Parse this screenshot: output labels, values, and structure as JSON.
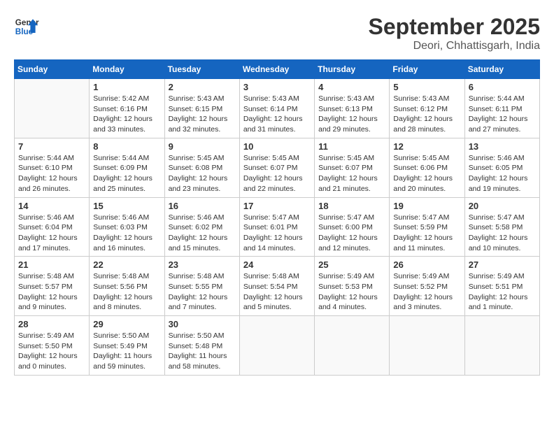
{
  "header": {
    "logo_general": "General",
    "logo_blue": "Blue",
    "month": "September 2025",
    "location": "Deori, Chhattisgarh, India"
  },
  "days_of_week": [
    "Sunday",
    "Monday",
    "Tuesday",
    "Wednesday",
    "Thursday",
    "Friday",
    "Saturday"
  ],
  "weeks": [
    [
      {
        "day": "",
        "info": ""
      },
      {
        "day": "1",
        "info": "Sunrise: 5:42 AM\nSunset: 6:16 PM\nDaylight: 12 hours\nand 33 minutes."
      },
      {
        "day": "2",
        "info": "Sunrise: 5:43 AM\nSunset: 6:15 PM\nDaylight: 12 hours\nand 32 minutes."
      },
      {
        "day": "3",
        "info": "Sunrise: 5:43 AM\nSunset: 6:14 PM\nDaylight: 12 hours\nand 31 minutes."
      },
      {
        "day": "4",
        "info": "Sunrise: 5:43 AM\nSunset: 6:13 PM\nDaylight: 12 hours\nand 29 minutes."
      },
      {
        "day": "5",
        "info": "Sunrise: 5:43 AM\nSunset: 6:12 PM\nDaylight: 12 hours\nand 28 minutes."
      },
      {
        "day": "6",
        "info": "Sunrise: 5:44 AM\nSunset: 6:11 PM\nDaylight: 12 hours\nand 27 minutes."
      }
    ],
    [
      {
        "day": "7",
        "info": "Sunrise: 5:44 AM\nSunset: 6:10 PM\nDaylight: 12 hours\nand 26 minutes."
      },
      {
        "day": "8",
        "info": "Sunrise: 5:44 AM\nSunset: 6:09 PM\nDaylight: 12 hours\nand 25 minutes."
      },
      {
        "day": "9",
        "info": "Sunrise: 5:45 AM\nSunset: 6:08 PM\nDaylight: 12 hours\nand 23 minutes."
      },
      {
        "day": "10",
        "info": "Sunrise: 5:45 AM\nSunset: 6:07 PM\nDaylight: 12 hours\nand 22 minutes."
      },
      {
        "day": "11",
        "info": "Sunrise: 5:45 AM\nSunset: 6:07 PM\nDaylight: 12 hours\nand 21 minutes."
      },
      {
        "day": "12",
        "info": "Sunrise: 5:45 AM\nSunset: 6:06 PM\nDaylight: 12 hours\nand 20 minutes."
      },
      {
        "day": "13",
        "info": "Sunrise: 5:46 AM\nSunset: 6:05 PM\nDaylight: 12 hours\nand 19 minutes."
      }
    ],
    [
      {
        "day": "14",
        "info": "Sunrise: 5:46 AM\nSunset: 6:04 PM\nDaylight: 12 hours\nand 17 minutes."
      },
      {
        "day": "15",
        "info": "Sunrise: 5:46 AM\nSunset: 6:03 PM\nDaylight: 12 hours\nand 16 minutes."
      },
      {
        "day": "16",
        "info": "Sunrise: 5:46 AM\nSunset: 6:02 PM\nDaylight: 12 hours\nand 15 minutes."
      },
      {
        "day": "17",
        "info": "Sunrise: 5:47 AM\nSunset: 6:01 PM\nDaylight: 12 hours\nand 14 minutes."
      },
      {
        "day": "18",
        "info": "Sunrise: 5:47 AM\nSunset: 6:00 PM\nDaylight: 12 hours\nand 12 minutes."
      },
      {
        "day": "19",
        "info": "Sunrise: 5:47 AM\nSunset: 5:59 PM\nDaylight: 12 hours\nand 11 minutes."
      },
      {
        "day": "20",
        "info": "Sunrise: 5:47 AM\nSunset: 5:58 PM\nDaylight: 12 hours\nand 10 minutes."
      }
    ],
    [
      {
        "day": "21",
        "info": "Sunrise: 5:48 AM\nSunset: 5:57 PM\nDaylight: 12 hours\nand 9 minutes."
      },
      {
        "day": "22",
        "info": "Sunrise: 5:48 AM\nSunset: 5:56 PM\nDaylight: 12 hours\nand 8 minutes."
      },
      {
        "day": "23",
        "info": "Sunrise: 5:48 AM\nSunset: 5:55 PM\nDaylight: 12 hours\nand 7 minutes."
      },
      {
        "day": "24",
        "info": "Sunrise: 5:48 AM\nSunset: 5:54 PM\nDaylight: 12 hours\nand 5 minutes."
      },
      {
        "day": "25",
        "info": "Sunrise: 5:49 AM\nSunset: 5:53 PM\nDaylight: 12 hours\nand 4 minutes."
      },
      {
        "day": "26",
        "info": "Sunrise: 5:49 AM\nSunset: 5:52 PM\nDaylight: 12 hours\nand 3 minutes."
      },
      {
        "day": "27",
        "info": "Sunrise: 5:49 AM\nSunset: 5:51 PM\nDaylight: 12 hours\nand 1 minute."
      }
    ],
    [
      {
        "day": "28",
        "info": "Sunrise: 5:49 AM\nSunset: 5:50 PM\nDaylight: 12 hours\nand 0 minutes."
      },
      {
        "day": "29",
        "info": "Sunrise: 5:50 AM\nSunset: 5:49 PM\nDaylight: 11 hours\nand 59 minutes."
      },
      {
        "day": "30",
        "info": "Sunrise: 5:50 AM\nSunset: 5:48 PM\nDaylight: 11 hours\nand 58 minutes."
      },
      {
        "day": "",
        "info": ""
      },
      {
        "day": "",
        "info": ""
      },
      {
        "day": "",
        "info": ""
      },
      {
        "day": "",
        "info": ""
      }
    ]
  ]
}
